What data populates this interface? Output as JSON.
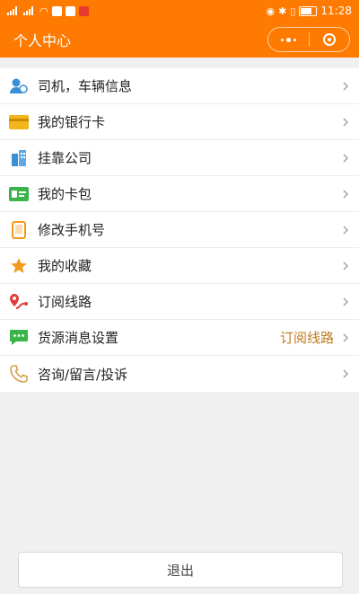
{
  "status_bar": {
    "time": "11:28",
    "colors": {
      "bg": "#ff7a00",
      "fg": "#ffffff"
    }
  },
  "header": {
    "title": "个人中心",
    "colors": {
      "bg": "#ff7a00",
      "fg": "#ffffff"
    }
  },
  "menu": {
    "items": [
      {
        "label": "司机，车辆信息",
        "icon": "driver-icon",
        "color": "#3a8fd6"
      },
      {
        "label": "我的银行卡",
        "icon": "bank-card-icon",
        "color": "#f2b61c"
      },
      {
        "label": "挂靠公司",
        "icon": "company-building-icon",
        "color": "#3a8fd6"
      },
      {
        "label": "我的卡包",
        "icon": "card-wallet-icon",
        "color": "#3bb54a"
      },
      {
        "label": "修改手机号",
        "icon": "phone-icon",
        "color": "#f29a1c"
      },
      {
        "label": "我的收藏",
        "icon": "star-icon",
        "color": "#f29a1c"
      },
      {
        "label": "订阅线路",
        "icon": "route-icon",
        "color": "#e23b3b"
      },
      {
        "label": "货源消息设置",
        "icon": "message-icon",
        "color": "#3bb54a",
        "extra": "订阅线路"
      },
      {
        "label": "咨询/留言/投诉",
        "icon": "phone-call-icon",
        "color": "#d3a04a"
      }
    ]
  },
  "footer": {
    "logout_label": "退出"
  }
}
